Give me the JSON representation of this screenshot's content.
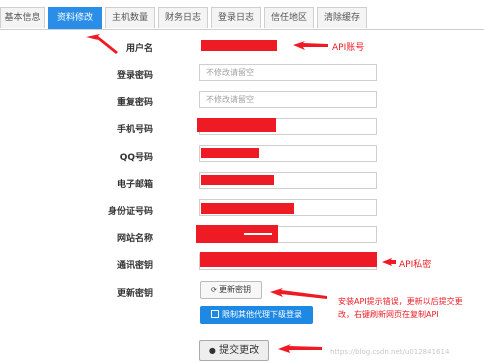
{
  "tabs": [
    "基本信息",
    "资料修改",
    "主机数量",
    "财务日志",
    "登录日志",
    "信任地区",
    "清除缓存"
  ],
  "active_tab": "资料修改",
  "form": {
    "username_label": "用户名",
    "login_password_label": "登录密码",
    "login_password_placeholder": "不修改请留空",
    "repeat_password_label": "重复密码",
    "repeat_password_placeholder": "不修改请留空",
    "phone_label": "手机号码",
    "qq_label": "QQ号码",
    "email_label": "电子邮箱",
    "idcard_label": "身份证号码",
    "site_label": "网站名称",
    "comm_key_label": "通讯密钥",
    "regen_key_label": "更新密钥",
    "regen_key_button": "更新密钥",
    "limit_agent_button": "限制其他代理下级登录",
    "submit_button": "提交更改"
  },
  "annotations": {
    "api_account": "API账号",
    "api_key": "API私密",
    "hint_line1": "安装API提示错误，更新以后提交更",
    "hint_line2": "改，右键刷新网页在复制API"
  },
  "watermark": "https://blog.csdn.net/u012841614",
  "colors": {
    "accent": "#2a8ee8",
    "annotation_red": "#ee1b24",
    "button_blue": "#1e88e5"
  }
}
